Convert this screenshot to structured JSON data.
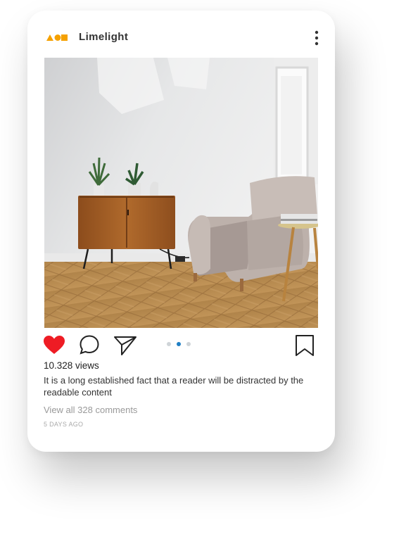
{
  "post": {
    "username": "Limelight",
    "views": "10.328 views",
    "caption": "It is a long established fact that a reader will be distracted by the readable content",
    "comments_link": "View all 328 comments",
    "timestamp": "5 DAYS AGO",
    "liked": true,
    "carousel": {
      "total": 3,
      "current": 2
    }
  },
  "icons": {
    "logo": "brand-logo-icon",
    "more": "more-vertical-icon",
    "like": "heart-filled-icon",
    "comment": "comment-bubble-icon",
    "share": "paper-plane-icon",
    "save": "bookmark-icon"
  },
  "colors": {
    "like": "#ee1c24",
    "logo": "#f5a100",
    "dot_active": "#1f7fc4",
    "dot_inactive": "#cfd4d8",
    "icon_stroke": "#222222"
  }
}
